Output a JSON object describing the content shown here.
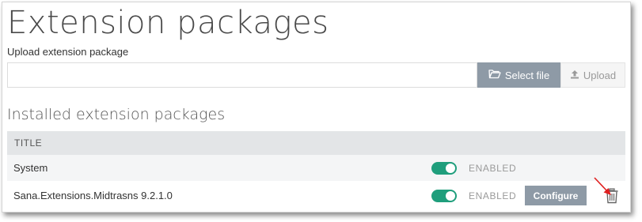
{
  "page": {
    "title": "Extension packages"
  },
  "upload": {
    "label": "Upload extension package",
    "file_input_value": "",
    "select_file_label": "Select file",
    "upload_label": "Upload"
  },
  "installed": {
    "section_title": "Installed extension packages",
    "column_title": "TITLE",
    "rows": [
      {
        "name": "System",
        "status": "ENABLED",
        "enabled": true
      },
      {
        "name": "Sana.Extensions.Midtrasns 9.2.1.0",
        "status": "ENABLED",
        "enabled": true,
        "configure_label": "Configure"
      }
    ]
  },
  "colors": {
    "accent_button": "#8e9aa6",
    "toggle_on": "#1f9e7c",
    "header_bg": "#e3e5e7",
    "annotation_arrow": "#e02020"
  },
  "icons": {
    "select_file": "folder-open-icon",
    "upload": "upload-icon",
    "delete": "trash-icon",
    "annotation": "red-arrow-icon"
  }
}
